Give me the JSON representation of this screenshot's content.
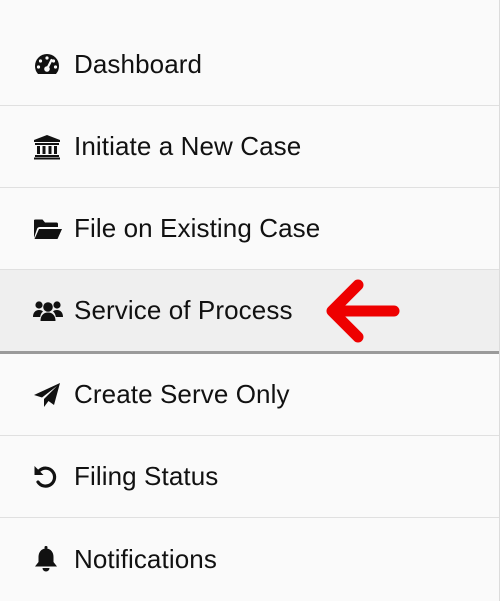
{
  "menu": {
    "items": [
      {
        "label": "Dashboard",
        "icon": "dashboard-icon"
      },
      {
        "label": "Initiate a New Case",
        "icon": "bank-icon"
      },
      {
        "label": "File on Existing Case",
        "icon": "folder-open-icon"
      },
      {
        "label": "Service of Process",
        "icon": "users-icon",
        "active": true
      },
      {
        "label": "Create Serve Only",
        "icon": "paper-plane-icon"
      },
      {
        "label": "Filing Status",
        "icon": "undo-icon"
      },
      {
        "label": "Notifications",
        "icon": "bell-icon"
      }
    ]
  },
  "colors": {
    "text": "#111111",
    "active_background": "#efefef",
    "annotation_arrow": "#ee0000"
  }
}
